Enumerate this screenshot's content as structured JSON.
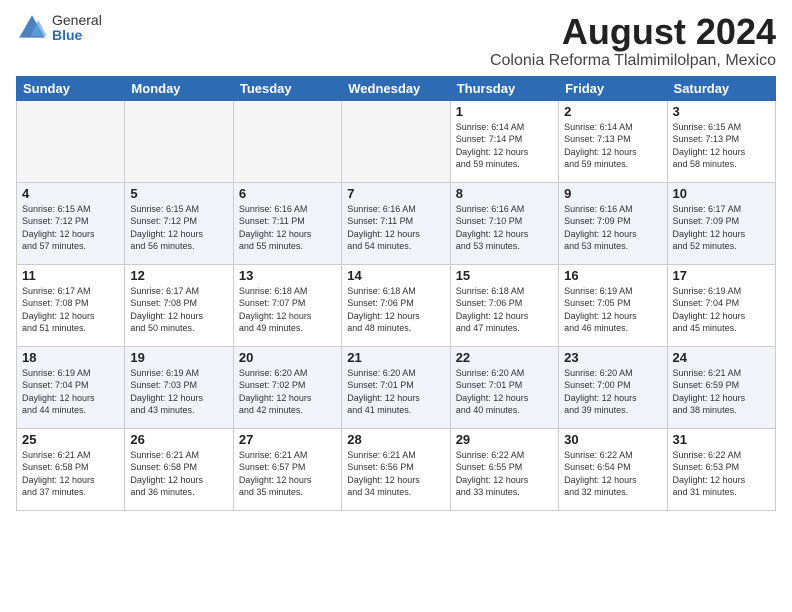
{
  "logo": {
    "general": "General",
    "blue": "Blue"
  },
  "header": {
    "month_year": "August 2024",
    "location": "Colonia Reforma Tlalmimilolpan, Mexico"
  },
  "days_of_week": [
    "Sunday",
    "Monday",
    "Tuesday",
    "Wednesday",
    "Thursday",
    "Friday",
    "Saturday"
  ],
  "weeks": [
    [
      {
        "day": "",
        "info": ""
      },
      {
        "day": "",
        "info": ""
      },
      {
        "day": "",
        "info": ""
      },
      {
        "day": "",
        "info": ""
      },
      {
        "day": "1",
        "info": "Sunrise: 6:14 AM\nSunset: 7:14 PM\nDaylight: 12 hours\nand 59 minutes."
      },
      {
        "day": "2",
        "info": "Sunrise: 6:14 AM\nSunset: 7:13 PM\nDaylight: 12 hours\nand 59 minutes."
      },
      {
        "day": "3",
        "info": "Sunrise: 6:15 AM\nSunset: 7:13 PM\nDaylight: 12 hours\nand 58 minutes."
      }
    ],
    [
      {
        "day": "4",
        "info": "Sunrise: 6:15 AM\nSunset: 7:12 PM\nDaylight: 12 hours\nand 57 minutes."
      },
      {
        "day": "5",
        "info": "Sunrise: 6:15 AM\nSunset: 7:12 PM\nDaylight: 12 hours\nand 56 minutes."
      },
      {
        "day": "6",
        "info": "Sunrise: 6:16 AM\nSunset: 7:11 PM\nDaylight: 12 hours\nand 55 minutes."
      },
      {
        "day": "7",
        "info": "Sunrise: 6:16 AM\nSunset: 7:11 PM\nDaylight: 12 hours\nand 54 minutes."
      },
      {
        "day": "8",
        "info": "Sunrise: 6:16 AM\nSunset: 7:10 PM\nDaylight: 12 hours\nand 53 minutes."
      },
      {
        "day": "9",
        "info": "Sunrise: 6:16 AM\nSunset: 7:09 PM\nDaylight: 12 hours\nand 53 minutes."
      },
      {
        "day": "10",
        "info": "Sunrise: 6:17 AM\nSunset: 7:09 PM\nDaylight: 12 hours\nand 52 minutes."
      }
    ],
    [
      {
        "day": "11",
        "info": "Sunrise: 6:17 AM\nSunset: 7:08 PM\nDaylight: 12 hours\nand 51 minutes."
      },
      {
        "day": "12",
        "info": "Sunrise: 6:17 AM\nSunset: 7:08 PM\nDaylight: 12 hours\nand 50 minutes."
      },
      {
        "day": "13",
        "info": "Sunrise: 6:18 AM\nSunset: 7:07 PM\nDaylight: 12 hours\nand 49 minutes."
      },
      {
        "day": "14",
        "info": "Sunrise: 6:18 AM\nSunset: 7:06 PM\nDaylight: 12 hours\nand 48 minutes."
      },
      {
        "day": "15",
        "info": "Sunrise: 6:18 AM\nSunset: 7:06 PM\nDaylight: 12 hours\nand 47 minutes."
      },
      {
        "day": "16",
        "info": "Sunrise: 6:19 AM\nSunset: 7:05 PM\nDaylight: 12 hours\nand 46 minutes."
      },
      {
        "day": "17",
        "info": "Sunrise: 6:19 AM\nSunset: 7:04 PM\nDaylight: 12 hours\nand 45 minutes."
      }
    ],
    [
      {
        "day": "18",
        "info": "Sunrise: 6:19 AM\nSunset: 7:04 PM\nDaylight: 12 hours\nand 44 minutes."
      },
      {
        "day": "19",
        "info": "Sunrise: 6:19 AM\nSunset: 7:03 PM\nDaylight: 12 hours\nand 43 minutes."
      },
      {
        "day": "20",
        "info": "Sunrise: 6:20 AM\nSunset: 7:02 PM\nDaylight: 12 hours\nand 42 minutes."
      },
      {
        "day": "21",
        "info": "Sunrise: 6:20 AM\nSunset: 7:01 PM\nDaylight: 12 hours\nand 41 minutes."
      },
      {
        "day": "22",
        "info": "Sunrise: 6:20 AM\nSunset: 7:01 PM\nDaylight: 12 hours\nand 40 minutes."
      },
      {
        "day": "23",
        "info": "Sunrise: 6:20 AM\nSunset: 7:00 PM\nDaylight: 12 hours\nand 39 minutes."
      },
      {
        "day": "24",
        "info": "Sunrise: 6:21 AM\nSunset: 6:59 PM\nDaylight: 12 hours\nand 38 minutes."
      }
    ],
    [
      {
        "day": "25",
        "info": "Sunrise: 6:21 AM\nSunset: 6:58 PM\nDaylight: 12 hours\nand 37 minutes."
      },
      {
        "day": "26",
        "info": "Sunrise: 6:21 AM\nSunset: 6:58 PM\nDaylight: 12 hours\nand 36 minutes."
      },
      {
        "day": "27",
        "info": "Sunrise: 6:21 AM\nSunset: 6:57 PM\nDaylight: 12 hours\nand 35 minutes."
      },
      {
        "day": "28",
        "info": "Sunrise: 6:21 AM\nSunset: 6:56 PM\nDaylight: 12 hours\nand 34 minutes."
      },
      {
        "day": "29",
        "info": "Sunrise: 6:22 AM\nSunset: 6:55 PM\nDaylight: 12 hours\nand 33 minutes."
      },
      {
        "day": "30",
        "info": "Sunrise: 6:22 AM\nSunset: 6:54 PM\nDaylight: 12 hours\nand 32 minutes."
      },
      {
        "day": "31",
        "info": "Sunrise: 6:22 AM\nSunset: 6:53 PM\nDaylight: 12 hours\nand 31 minutes."
      }
    ]
  ]
}
